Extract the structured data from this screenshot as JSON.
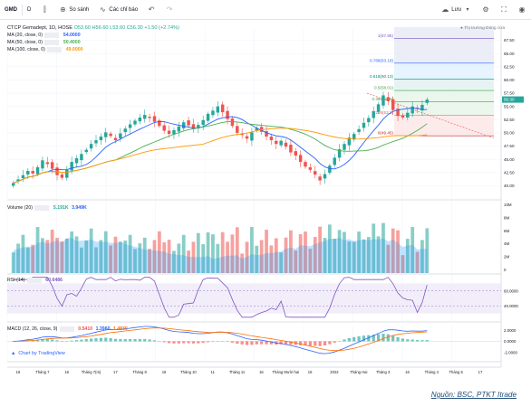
{
  "toolbar": {
    "symbol": "GMD",
    "interval": "D",
    "compare_label": "So sánh",
    "indicators_label": "Các chỉ báo",
    "save_label": "Lưu"
  },
  "main_legend": {
    "title": "CTCP Gemadept, 1D, HOSE",
    "ohlc": "O53.60 H56.60 L53.60 C56.30 +1.50 (+2.74%)",
    "ma1_label": "MA (20, close, 0)",
    "ma1_value": "54.0000",
    "ma2_label": "MA (50, close, 0)",
    "ma2_value": "50.4000",
    "ma3_label": "MA (100, close, 0)",
    "ma3_value": "49.0000",
    "market_status": "Thị trường Đóng cửa"
  },
  "volume_legend": {
    "label": "Volume (20)",
    "v1": "5.191K",
    "v2": "3.949K"
  },
  "rsi_legend": {
    "label": "RSI (14)",
    "value": "60.6486"
  },
  "macd_legend": {
    "label": "MACD (12, 26, close, 9)",
    "v1": "0.5410",
    "v2": "1.3960",
    "v3": "1.4830"
  },
  "branding": {
    "text": "Chart by TradingView"
  },
  "source_note": "Nguồn: BSC, PTKT Itrade",
  "colors": {
    "up": "#26a69a",
    "down": "#ef5350",
    "ma20": "#2962ff",
    "ma50": "#4caf50",
    "ma100": "#ff9800",
    "rsi": "#7e57c2",
    "macd": "#2962ff",
    "signal": "#ff6d00"
  },
  "chart_data": [
    {
      "type": "candlestick",
      "title": "CTCP Gemadept, 1D, HOSE",
      "ylim": [
        37.5,
        70.0
      ],
      "y_ticks": [
        "67.50",
        "65.00",
        "62.50",
        "60.00",
        "57.50",
        "55.00",
        "52.50",
        "50.00",
        "47.50",
        "45.00",
        "42.50",
        "40.00"
      ],
      "x_ticks": [
        "16",
        "Tháng 7",
        "16",
        "Tháng 7(m)",
        "17",
        "Tháng 8",
        "16",
        "Tháng 10",
        "11",
        "Tháng 11",
        "16",
        "Tháng Mười hai",
        "16",
        "2022",
        "Tháng Hai",
        "Tháng 3",
        "16",
        "Tháng 4",
        "Tháng 5",
        "17"
      ],
      "close_series": [
        40.5,
        41.2,
        42.0,
        42.8,
        42.3,
        43.5,
        44.8,
        44.1,
        43.2,
        42.0,
        41.5,
        43.0,
        44.5,
        45.2,
        46.0,
        46.8,
        47.9,
        48.6,
        49.3,
        50.1,
        49.4,
        48.6,
        49.9,
        50.8,
        51.6,
        52.3,
        52.9,
        53.4,
        52.8,
        52.1,
        51.3,
        50.4,
        49.8,
        50.5,
        51.2,
        52.0,
        51.4,
        50.7,
        51.5,
        52.4,
        53.6,
        54.2,
        55.0,
        53.9,
        52.6,
        51.3,
        50.0,
        49.6,
        48.9,
        50.1,
        50.9,
        50.2,
        49.3,
        48.6,
        47.9,
        48.5,
        47.4,
        46.3,
        45.7,
        44.5,
        43.6,
        43.0,
        42.1,
        41.0,
        42.2,
        43.8,
        45.3,
        46.9,
        47.9,
        49.1,
        49.8,
        50.7,
        51.9,
        52.8,
        54.1,
        55.4,
        57.1,
        56.0,
        54.3,
        53.2,
        52.9,
        53.8,
        55.0,
        54.6,
        55.3,
        56.3
      ],
      "ma_series": [
        {
          "name": "MA (20, close, 0)",
          "last": 54.0
        },
        {
          "name": "MA (50, close, 0)",
          "last": 50.4
        },
        {
          "name": "MA (100, close, 0)",
          "last": 49.0
        }
      ],
      "fibonacci": [
        {
          "label": "1(67.85)",
          "value": 67.85
        },
        {
          "label": "0.786(63.19)",
          "value": 63.19
        },
        {
          "label": "0.618(60.13)",
          "value": 60.13
        },
        {
          "label": "0.5(58.01)",
          "value": 58.01
        },
        {
          "label": "0.382(55.9)",
          "value": 55.9
        },
        {
          "label": "0.236(53.3)",
          "value": 53.3
        },
        {
          "label": "0(49.45)",
          "value": 49.45
        }
      ],
      "current_price": 56.3
    },
    {
      "type": "bar",
      "title": "Volume (20)",
      "y_ticks": [
        "10M",
        "8M",
        "6M",
        "4M",
        "2M",
        "0"
      ],
      "ylim": [
        0,
        10
      ],
      "unit": "M"
    },
    {
      "type": "line",
      "title": "RSI (14)",
      "ylim": [
        20,
        80
      ],
      "y_ticks": [
        "60.0000",
        "40.0000"
      ],
      "last": 60.6486
    },
    {
      "type": "line",
      "title": "MACD (12, 26, close, 9)",
      "ylim": [
        -3.5,
        3.0
      ],
      "y_ticks": [
        "2.0000",
        "0.0000",
        "-2.0000"
      ],
      "series": [
        {
          "name": "MACD",
          "last": 1.396
        },
        {
          "name": "Signal",
          "last": 1.483
        },
        {
          "name": "Histogram",
          "last": 0.541
        }
      ]
    }
  ]
}
